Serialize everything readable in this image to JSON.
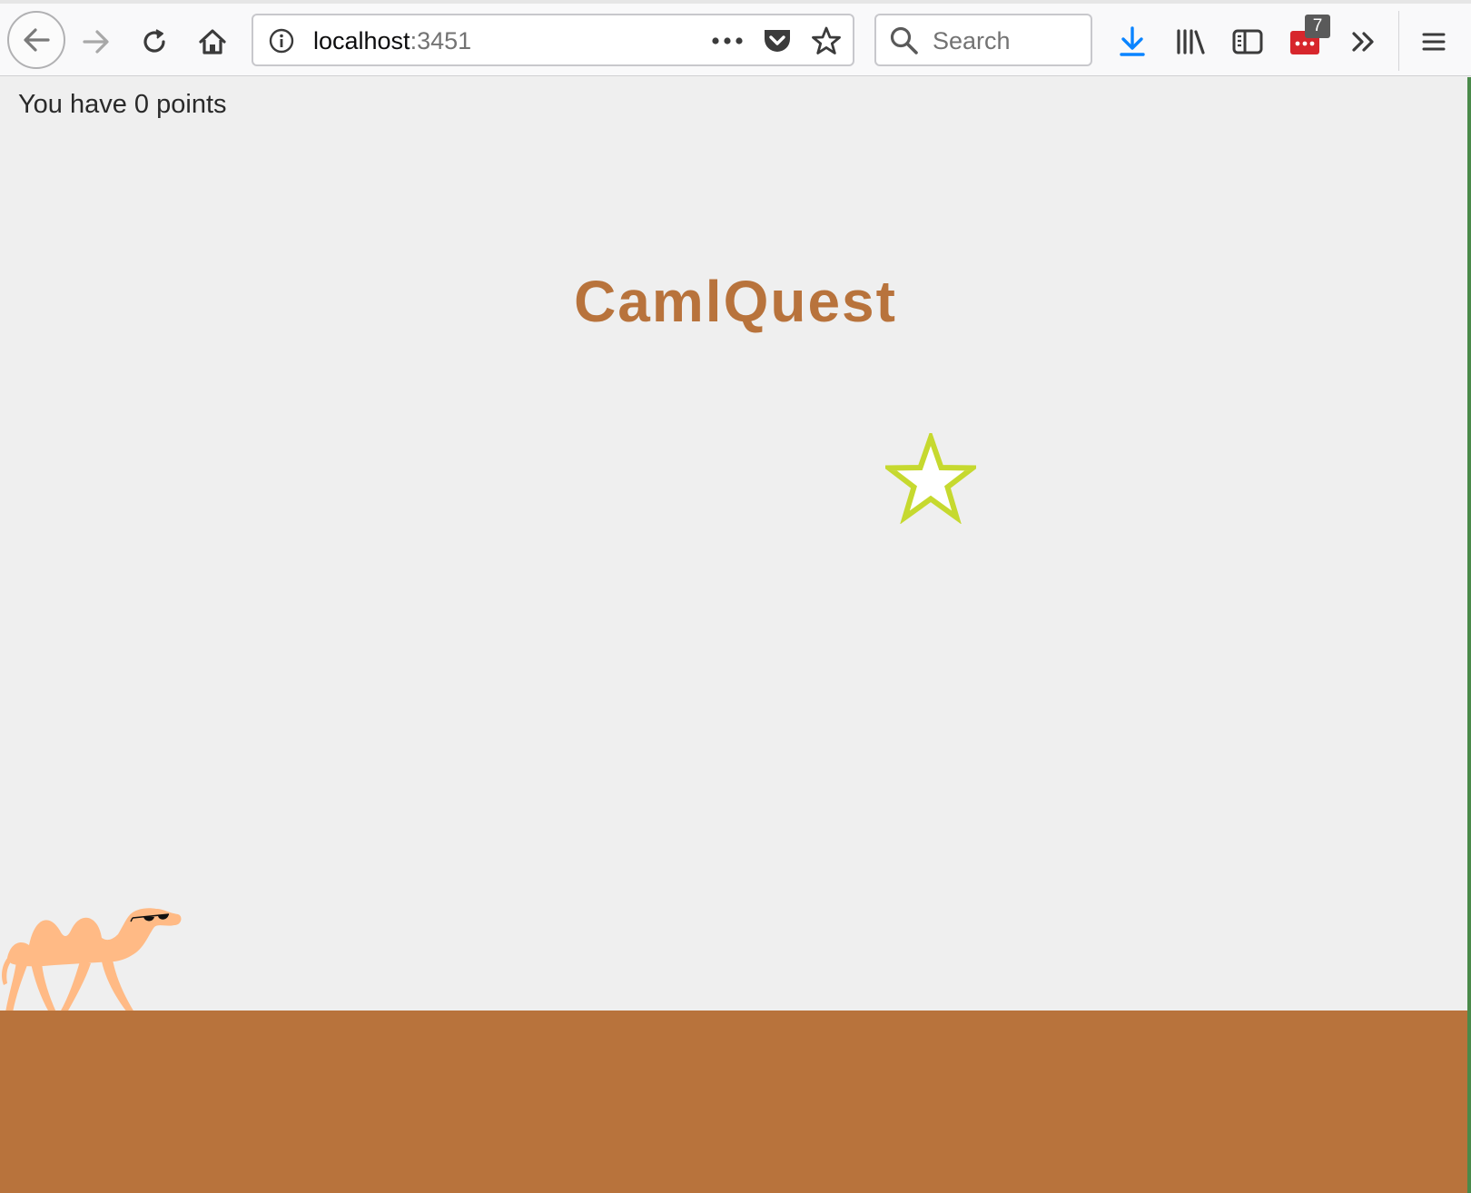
{
  "browser": {
    "url_host": "localhost",
    "url_port": ":3451",
    "search_placeholder": "Search",
    "extension_badge": "7",
    "accent_color": "#0a84ff"
  },
  "icons": {
    "back": "back-arrow-icon",
    "forward": "forward-arrow-icon",
    "reload": "reload-icon",
    "home": "home-icon",
    "info": "info-icon",
    "page_actions": "more-dots-icon",
    "pocket": "pocket-icon",
    "bookmark": "star-bookmark-icon",
    "search": "search-icon",
    "downloads": "download-arrow-icon",
    "library": "library-icon",
    "sidebar": "sidebar-icon",
    "extension": "extension-icon",
    "overflow": "double-chevron-icon",
    "menu": "hamburger-menu-icon"
  },
  "game": {
    "score_text": "You have 0 points",
    "title": "CamlQuest",
    "title_color": "#b8733c",
    "ground_color": "#b8733c",
    "star_outline_color": "#c6d92f",
    "camel_color": "#ffba85"
  }
}
